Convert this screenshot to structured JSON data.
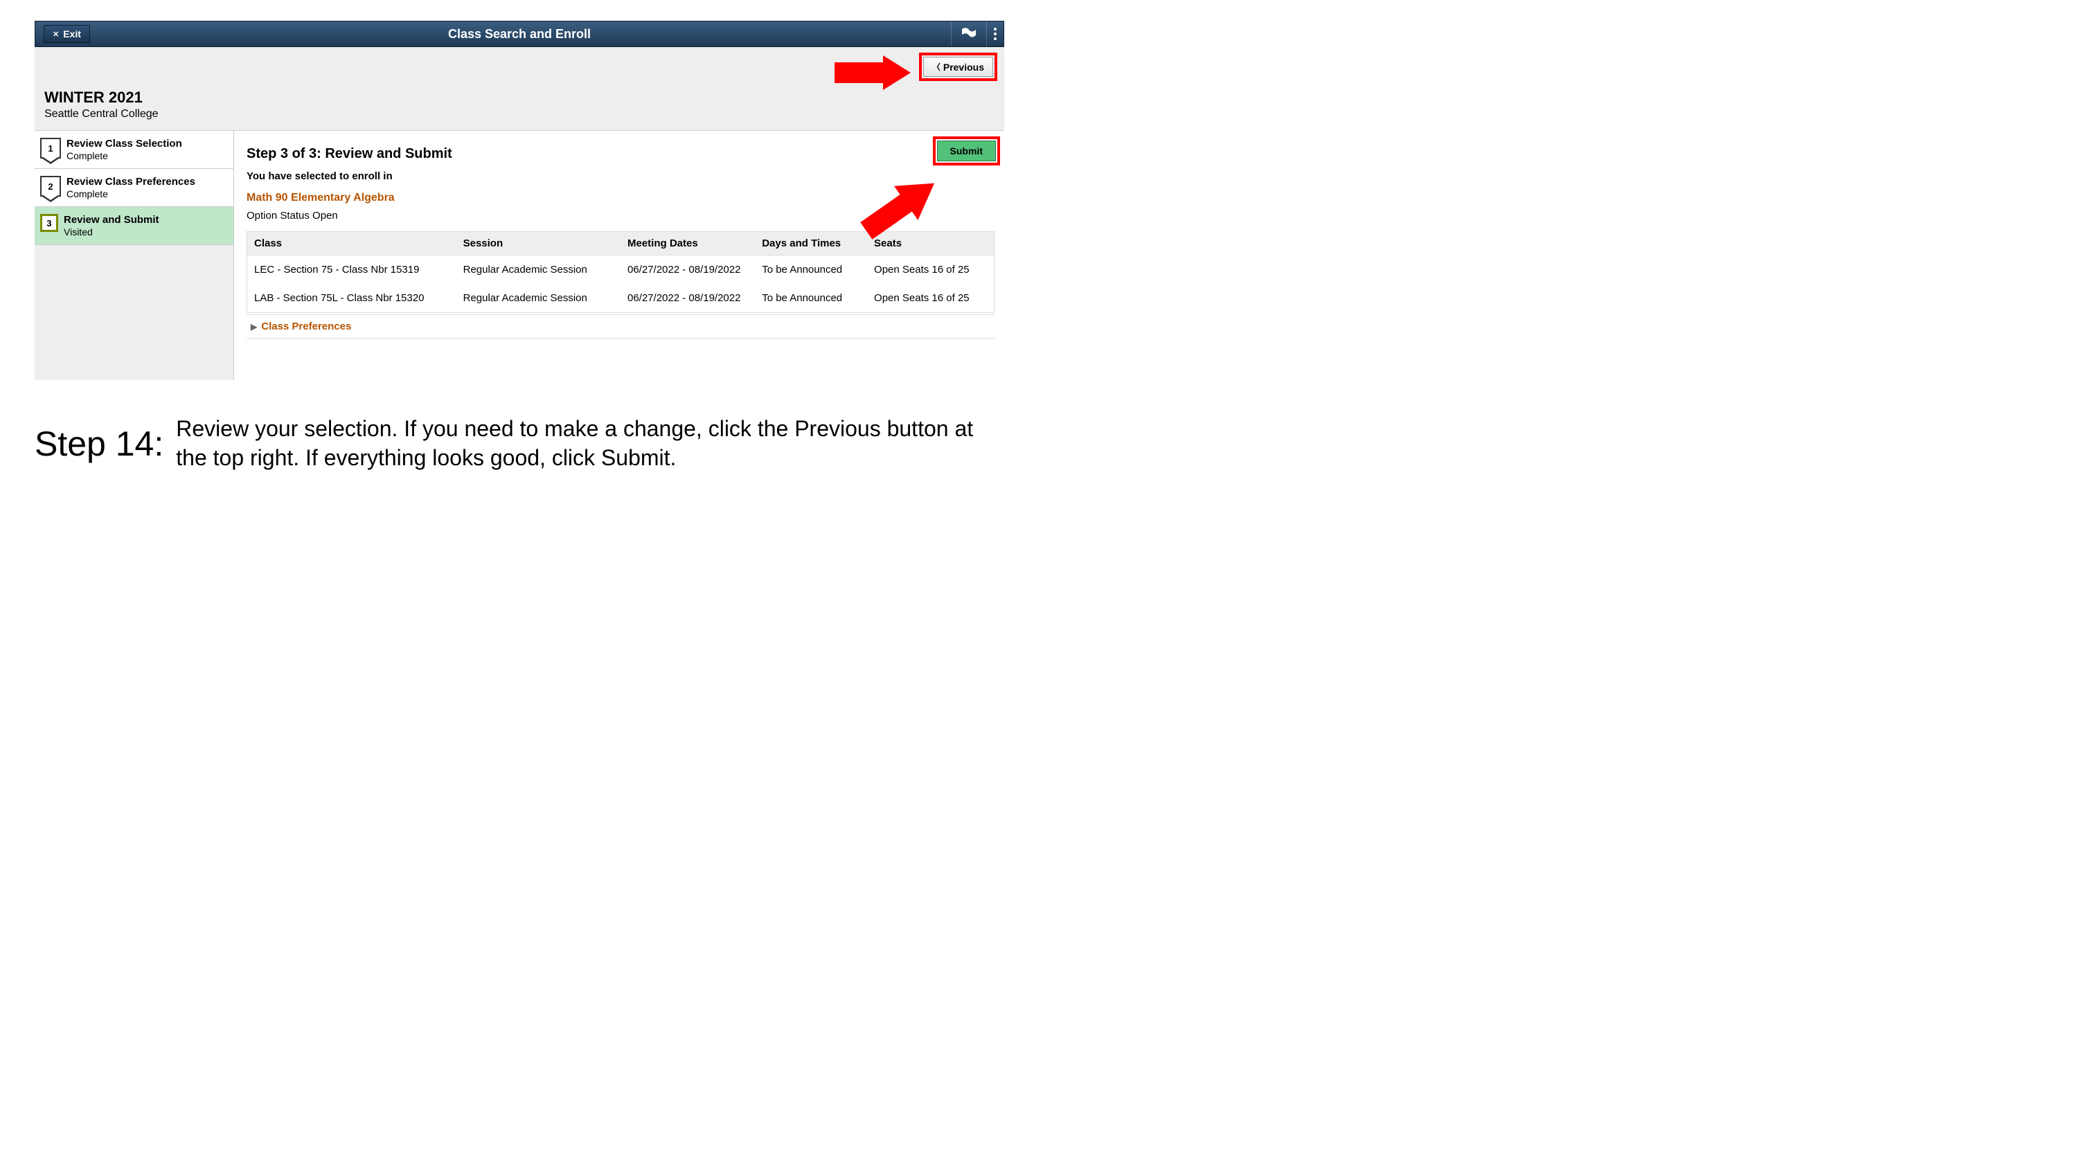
{
  "header": {
    "exit_label": "Exit",
    "title": "Class Search and Enroll"
  },
  "subheader": {
    "previous_label": "Previous",
    "term": "WINTER 2021",
    "college": "Seattle Central College"
  },
  "sidebar": {
    "steps": [
      {
        "num": "1",
        "title": "Review Class Selection",
        "status": "Complete"
      },
      {
        "num": "2",
        "title": "Review Class Preferences",
        "status": "Complete"
      },
      {
        "num": "3",
        "title": "Review and Submit",
        "status": "Visited"
      }
    ]
  },
  "main": {
    "submit_label": "Submit",
    "step_heading": "Step 3 of 3: Review and Submit",
    "sub_heading": "You have selected to enroll in",
    "course": "Math 90  Elementary Algebra",
    "option_status": "Option Status  Open",
    "columns": {
      "class": "Class",
      "session": "Session",
      "dates": "Meeting Dates",
      "times": "Days and Times",
      "seats": "Seats"
    },
    "rows": [
      {
        "class": "LEC - Section 75 - Class Nbr 15319",
        "session": "Regular Academic Session",
        "dates": "06/27/2022 - 08/19/2022",
        "times": "To be Announced",
        "seats": "Open Seats 16 of 25"
      },
      {
        "class": "LAB - Section 75L - Class Nbr 15320",
        "session": "Regular Academic Session",
        "dates": "06/27/2022 - 08/19/2022",
        "times": "To be Announced",
        "seats": "Open Seats 16 of 25"
      }
    ],
    "class_prefs_label": "Class Preferences"
  },
  "caption": {
    "step_label": "Step 14:",
    "text_1": "Review your selection. If you need to make a change, click the ",
    "kw_1": "Previous",
    "text_2": " button at the top right. If everything looks good, click ",
    "kw_2": "Submit",
    "text_3": "."
  }
}
